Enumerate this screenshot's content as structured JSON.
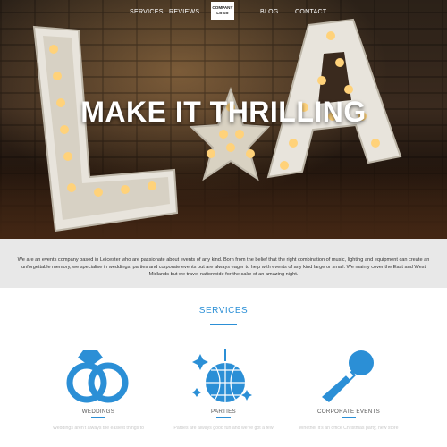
{
  "nav": {
    "items": [
      "SERVICES",
      "REVIEWS",
      "BLOG",
      "CONTACT"
    ],
    "logo": [
      "COMPANY",
      "LOGO"
    ]
  },
  "hero": {
    "headline": "MAKE IT THRILLING",
    "light_color": "#ffd27a"
  },
  "intro": {
    "text": "We are an events company based in Leicester who are passionate about events of any kind. Born from the belief that the right combination of music, lighting and equipment can create an unforgettable memory, we specialise in weddings, parties and corporate events but are always eager to help with events of any kind large or small. We mainly cover the East and West Midlands but we travel nationwide for the sake of an amazing night."
  },
  "services": {
    "title": "SERVICES",
    "accent_color": "#2b8fd6",
    "items": [
      {
        "label": "WEDDINGS",
        "icon": "wedding-rings-icon",
        "teaser": "Weddings aren't always the easiest things to"
      },
      {
        "label": "PARTIES",
        "icon": "disco-ball-icon",
        "teaser": "Parties are always good fun and we've got a few"
      },
      {
        "label": "CORPORATE EVENTS",
        "icon": "microphone-icon",
        "teaser": "Whether it's an office Christmas party, new store"
      }
    ]
  }
}
